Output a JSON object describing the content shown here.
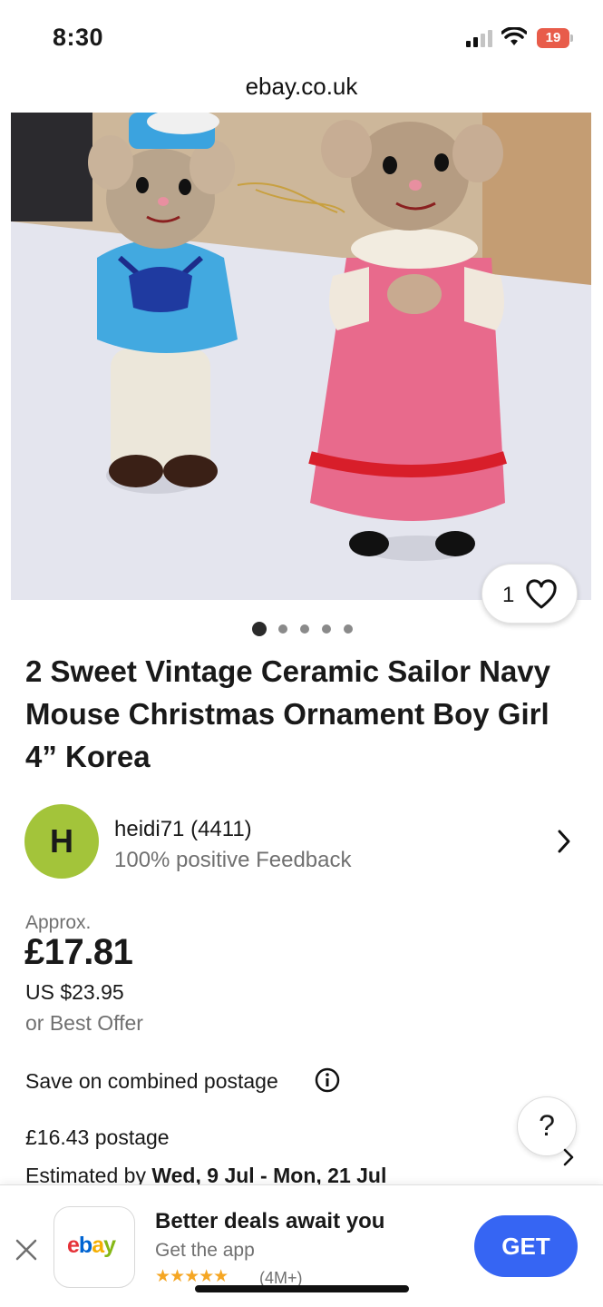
{
  "status_bar": {
    "time": "8:30",
    "battery": "19"
  },
  "browser": {
    "url": "ebay.co.uk"
  },
  "gallery": {
    "like_count": "1",
    "image_count": 5,
    "active_index": 0
  },
  "listing": {
    "title": "2 Sweet Vintage Ceramic Sailor Navy Mouse Christmas Ornament Boy Girl 4” Korea"
  },
  "seller": {
    "initial": "H",
    "name": "heidi71 (4411)",
    "feedback": "100% positive Feedback"
  },
  "price": {
    "approx_label": "Approx.",
    "gbp": "£17.81",
    "usd": "US $23.95",
    "best_offer": "or Best Offer"
  },
  "shipping": {
    "combined_label": "Save on combined postage",
    "postage": "£16.43 postage",
    "estimate_prefix": "Estimated by ",
    "estimate_dates": "Wed, 9 Jul - Mon, 21 Jul"
  },
  "help": {
    "label": "?"
  },
  "app_banner": {
    "logo": "ebay",
    "headline": "Better deals await you",
    "subtitle": "Get the app",
    "stars": "★★★★★",
    "rating_count": "(4M+)",
    "cta": "GET"
  },
  "colors": {
    "avatar": "#a3c43a",
    "cta_blue": "#3665f3",
    "battery_red": "#e85c4a",
    "star": "#f5a623"
  }
}
